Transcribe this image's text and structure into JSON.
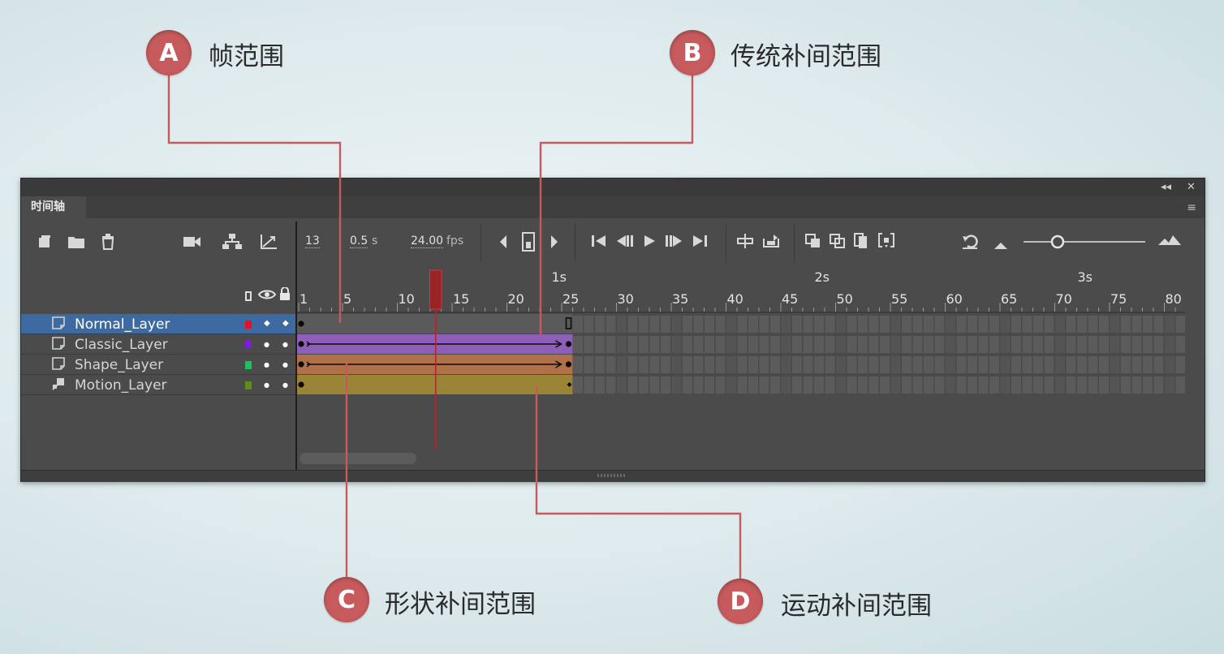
{
  "callouts": [
    {
      "badge": "A",
      "label": "帧范围"
    },
    {
      "badge": "B",
      "label": "传统补间范围"
    },
    {
      "badge": "C",
      "label": "形状补间范围"
    },
    {
      "badge": "D",
      "label": "运动补间范围"
    }
  ],
  "panel": {
    "title_tab": "时间轴",
    "collapse_glyph": "◂◂",
    "close_glyph": "✕",
    "menu_glyph": "≡"
  },
  "toolbar": {
    "current_frame": "13",
    "time_value": "0.5",
    "time_unit": "s",
    "fps_value": "24.00",
    "fps_unit": "fps",
    "icons": [
      "new-layer-icon",
      "new-folder-icon",
      "delete-icon",
      "camera-icon",
      "layer-parenting-icon",
      "graph-icon",
      "prev-keyframe-icon",
      "insert-keyframe-icon",
      "next-keyframe-icon",
      "go-first-icon",
      "step-back-icon",
      "play-icon",
      "step-forward-icon",
      "go-last-icon",
      "center-frame-icon",
      "loop-icon",
      "onion-skin-icon",
      "onion-outline-icon",
      "edit-multiple-icon",
      "onion-range-icon",
      "undo-icon",
      "zoom-small-icon",
      "zoom-slider",
      "zoom-large-icon"
    ]
  },
  "layers": [
    {
      "name": "Normal_Layer",
      "color": "#e8121c",
      "selected": true,
      "type": "normal",
      "visible_dot": "◆",
      "lock_dot": "◆"
    },
    {
      "name": "Classic_Layer",
      "color": "#7a1fd6",
      "selected": false,
      "type": "normal",
      "visible_dot": "●",
      "lock_dot": "●"
    },
    {
      "name": "Shape_Layer",
      "color": "#1ec25a",
      "selected": false,
      "type": "normal",
      "visible_dot": "●",
      "lock_dot": "●"
    },
    {
      "name": "Motion_Layer",
      "color": "#5c8f16",
      "selected": false,
      "type": "motion",
      "visible_dot": "●",
      "lock_dot": "●"
    }
  ],
  "ruler": {
    "frame_labels": [
      "1",
      "5",
      "10",
      "15",
      "20",
      "25",
      "30",
      "35",
      "40",
      "45",
      "50",
      "55",
      "60",
      "65",
      "70",
      "75",
      "80"
    ],
    "second_labels": [
      "1s",
      "2s",
      "3s"
    ],
    "playhead_frame": 13
  },
  "spans": [
    {
      "layer": "Normal_Layer",
      "kind": "frame",
      "color": "#5a5a5a",
      "start": 1,
      "end": 25
    },
    {
      "layer": "Classic_Layer",
      "kind": "classic-tween",
      "color": "#8d5fb8",
      "start": 1,
      "end": 25
    },
    {
      "layer": "Shape_Layer",
      "kind": "shape-tween",
      "color": "#b0704a",
      "start": 1,
      "end": 25
    },
    {
      "layer": "Motion_Layer",
      "kind": "motion-tween",
      "color": "#9a8536",
      "start": 1,
      "end": 25
    }
  ],
  "colors": {
    "accent": "#c65a5c",
    "panel": "#4b4b4b",
    "selected_row": "#3c6aa1",
    "playhead": "#b2262b"
  }
}
